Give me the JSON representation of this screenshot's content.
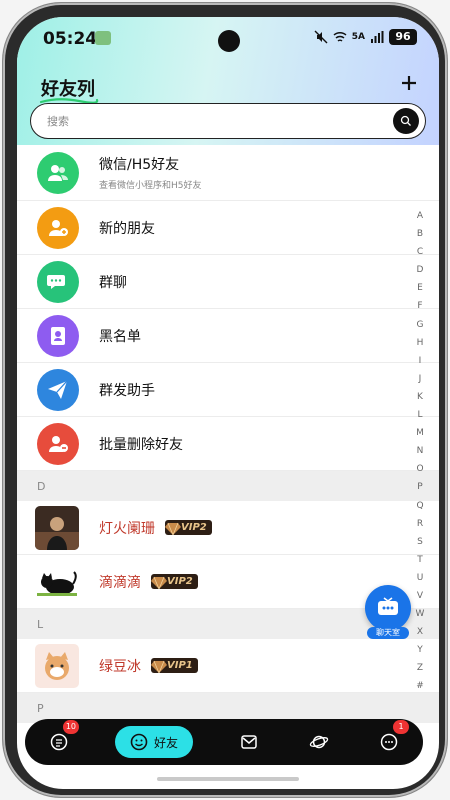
{
  "status_bar": {
    "time": "05:24",
    "network": "5A",
    "battery": "96"
  },
  "header": {
    "title": "好友列",
    "add_icon": "plus-icon"
  },
  "search": {
    "placeholder": "搜索"
  },
  "menu_items": [
    {
      "label": "微信/H5好友",
      "sublabel": "查看微信小程序和H5好友",
      "icon": "users-icon",
      "color": "#2ecc71"
    },
    {
      "label": "新的朋友",
      "icon": "add-friend-icon",
      "color": "#f39c12"
    },
    {
      "label": "群聊",
      "icon": "chat-bubbles-icon",
      "color": "#27c37a"
    },
    {
      "label": "黑名单",
      "icon": "id-badge-icon",
      "color": "#8e5cf0"
    },
    {
      "label": "群发助手",
      "icon": "paper-plane-icon",
      "color": "#2e86de"
    },
    {
      "label": "批量删除好友",
      "icon": "remove-user-icon",
      "color": "#e74c3c"
    }
  ],
  "sections": [
    {
      "letter": "D",
      "friends": [
        {
          "name": "灯火阑珊",
          "vip": "VIP2"
        },
        {
          "name": "滴滴滴",
          "vip": "VIP2"
        }
      ]
    },
    {
      "letter": "L",
      "friends": [
        {
          "name": "绿豆冰",
          "vip": "VIP1"
        }
      ]
    },
    {
      "letter": "P",
      "friends": []
    }
  ],
  "alphabet": [
    "A",
    "B",
    "C",
    "D",
    "E",
    "F",
    "G",
    "H",
    "I",
    "J",
    "K",
    "L",
    "M",
    "N",
    "O",
    "P",
    "Q",
    "R",
    "S",
    "T",
    "U",
    "V",
    "W",
    "X",
    "Y",
    "Z",
    "#"
  ],
  "floating": {
    "label": "聊天室"
  },
  "tabbar": [
    {
      "icon": "document-icon",
      "badge": "10"
    },
    {
      "icon": "smile-icon",
      "label": "好友",
      "active": true
    },
    {
      "icon": "mail-icon"
    },
    {
      "icon": "planet-icon"
    },
    {
      "icon": "chat-icon",
      "badge": "1"
    }
  ]
}
